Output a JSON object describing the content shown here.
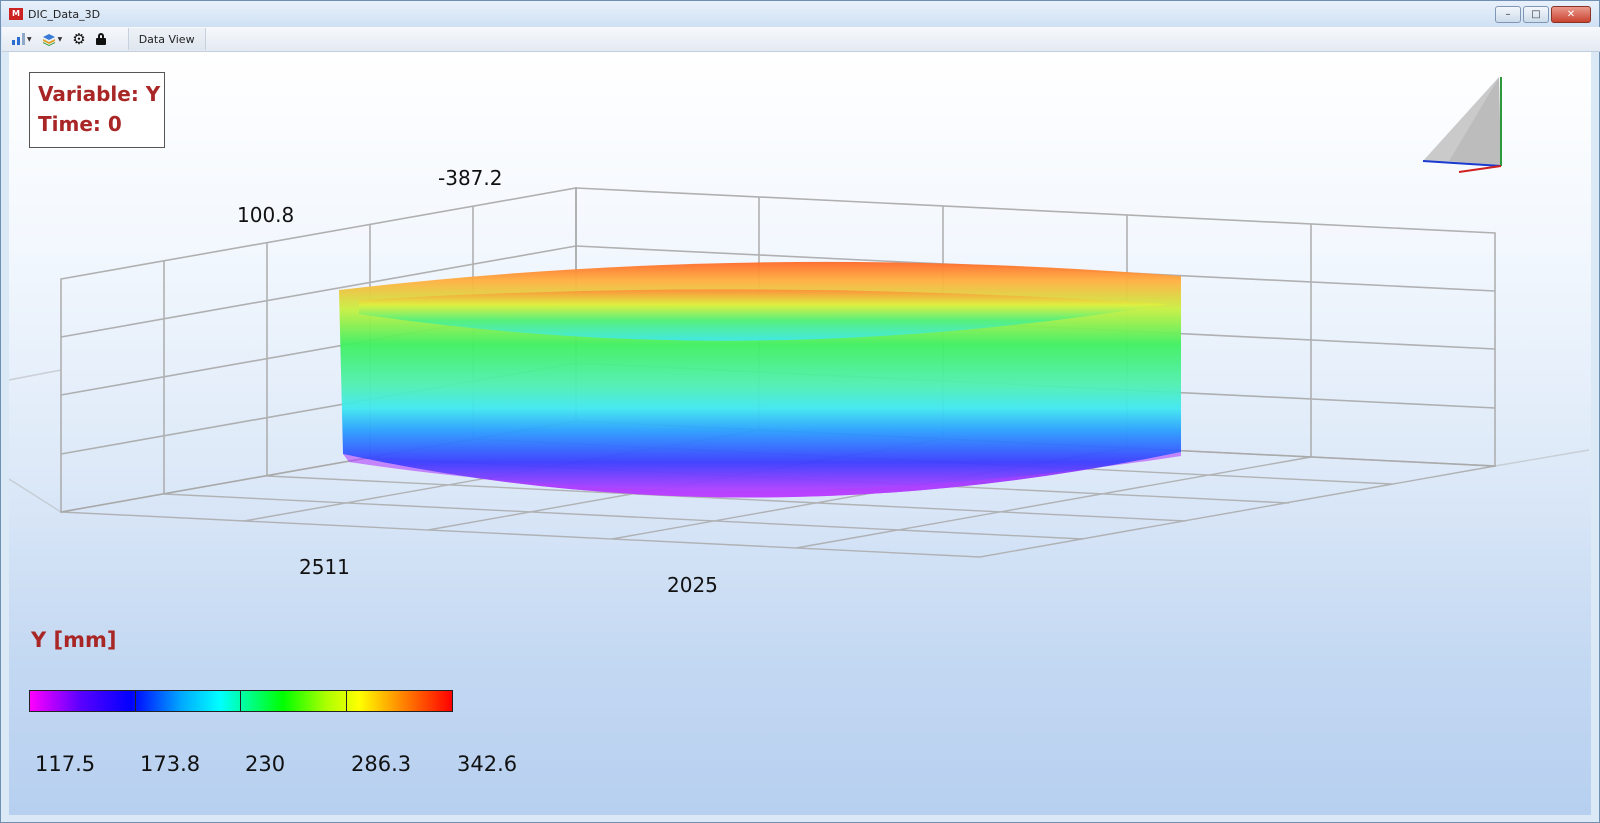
{
  "window": {
    "title": "DIC_Data_3D",
    "controls": {
      "minimize": "–",
      "maximize": "□",
      "close": "✕"
    }
  },
  "toolbar": {
    "icons": [
      "bar-chart-icon",
      "layers-icon",
      "gear-icon",
      "lock-icon"
    ],
    "tab_label": "Data View"
  },
  "info": {
    "variable_line": "Variable: Y",
    "time_line": "Time: 0"
  },
  "axes": {
    "labels": [
      "-387.2",
      "100.8",
      "2511",
      "2025"
    ]
  },
  "legend": {
    "title": "Y [mm]",
    "ticks": [
      "117.5",
      "173.8",
      "230",
      "286.3",
      "342.6"
    ]
  },
  "colors": {
    "accent_text": "#a82626",
    "grid": "#a9a9a9"
  }
}
